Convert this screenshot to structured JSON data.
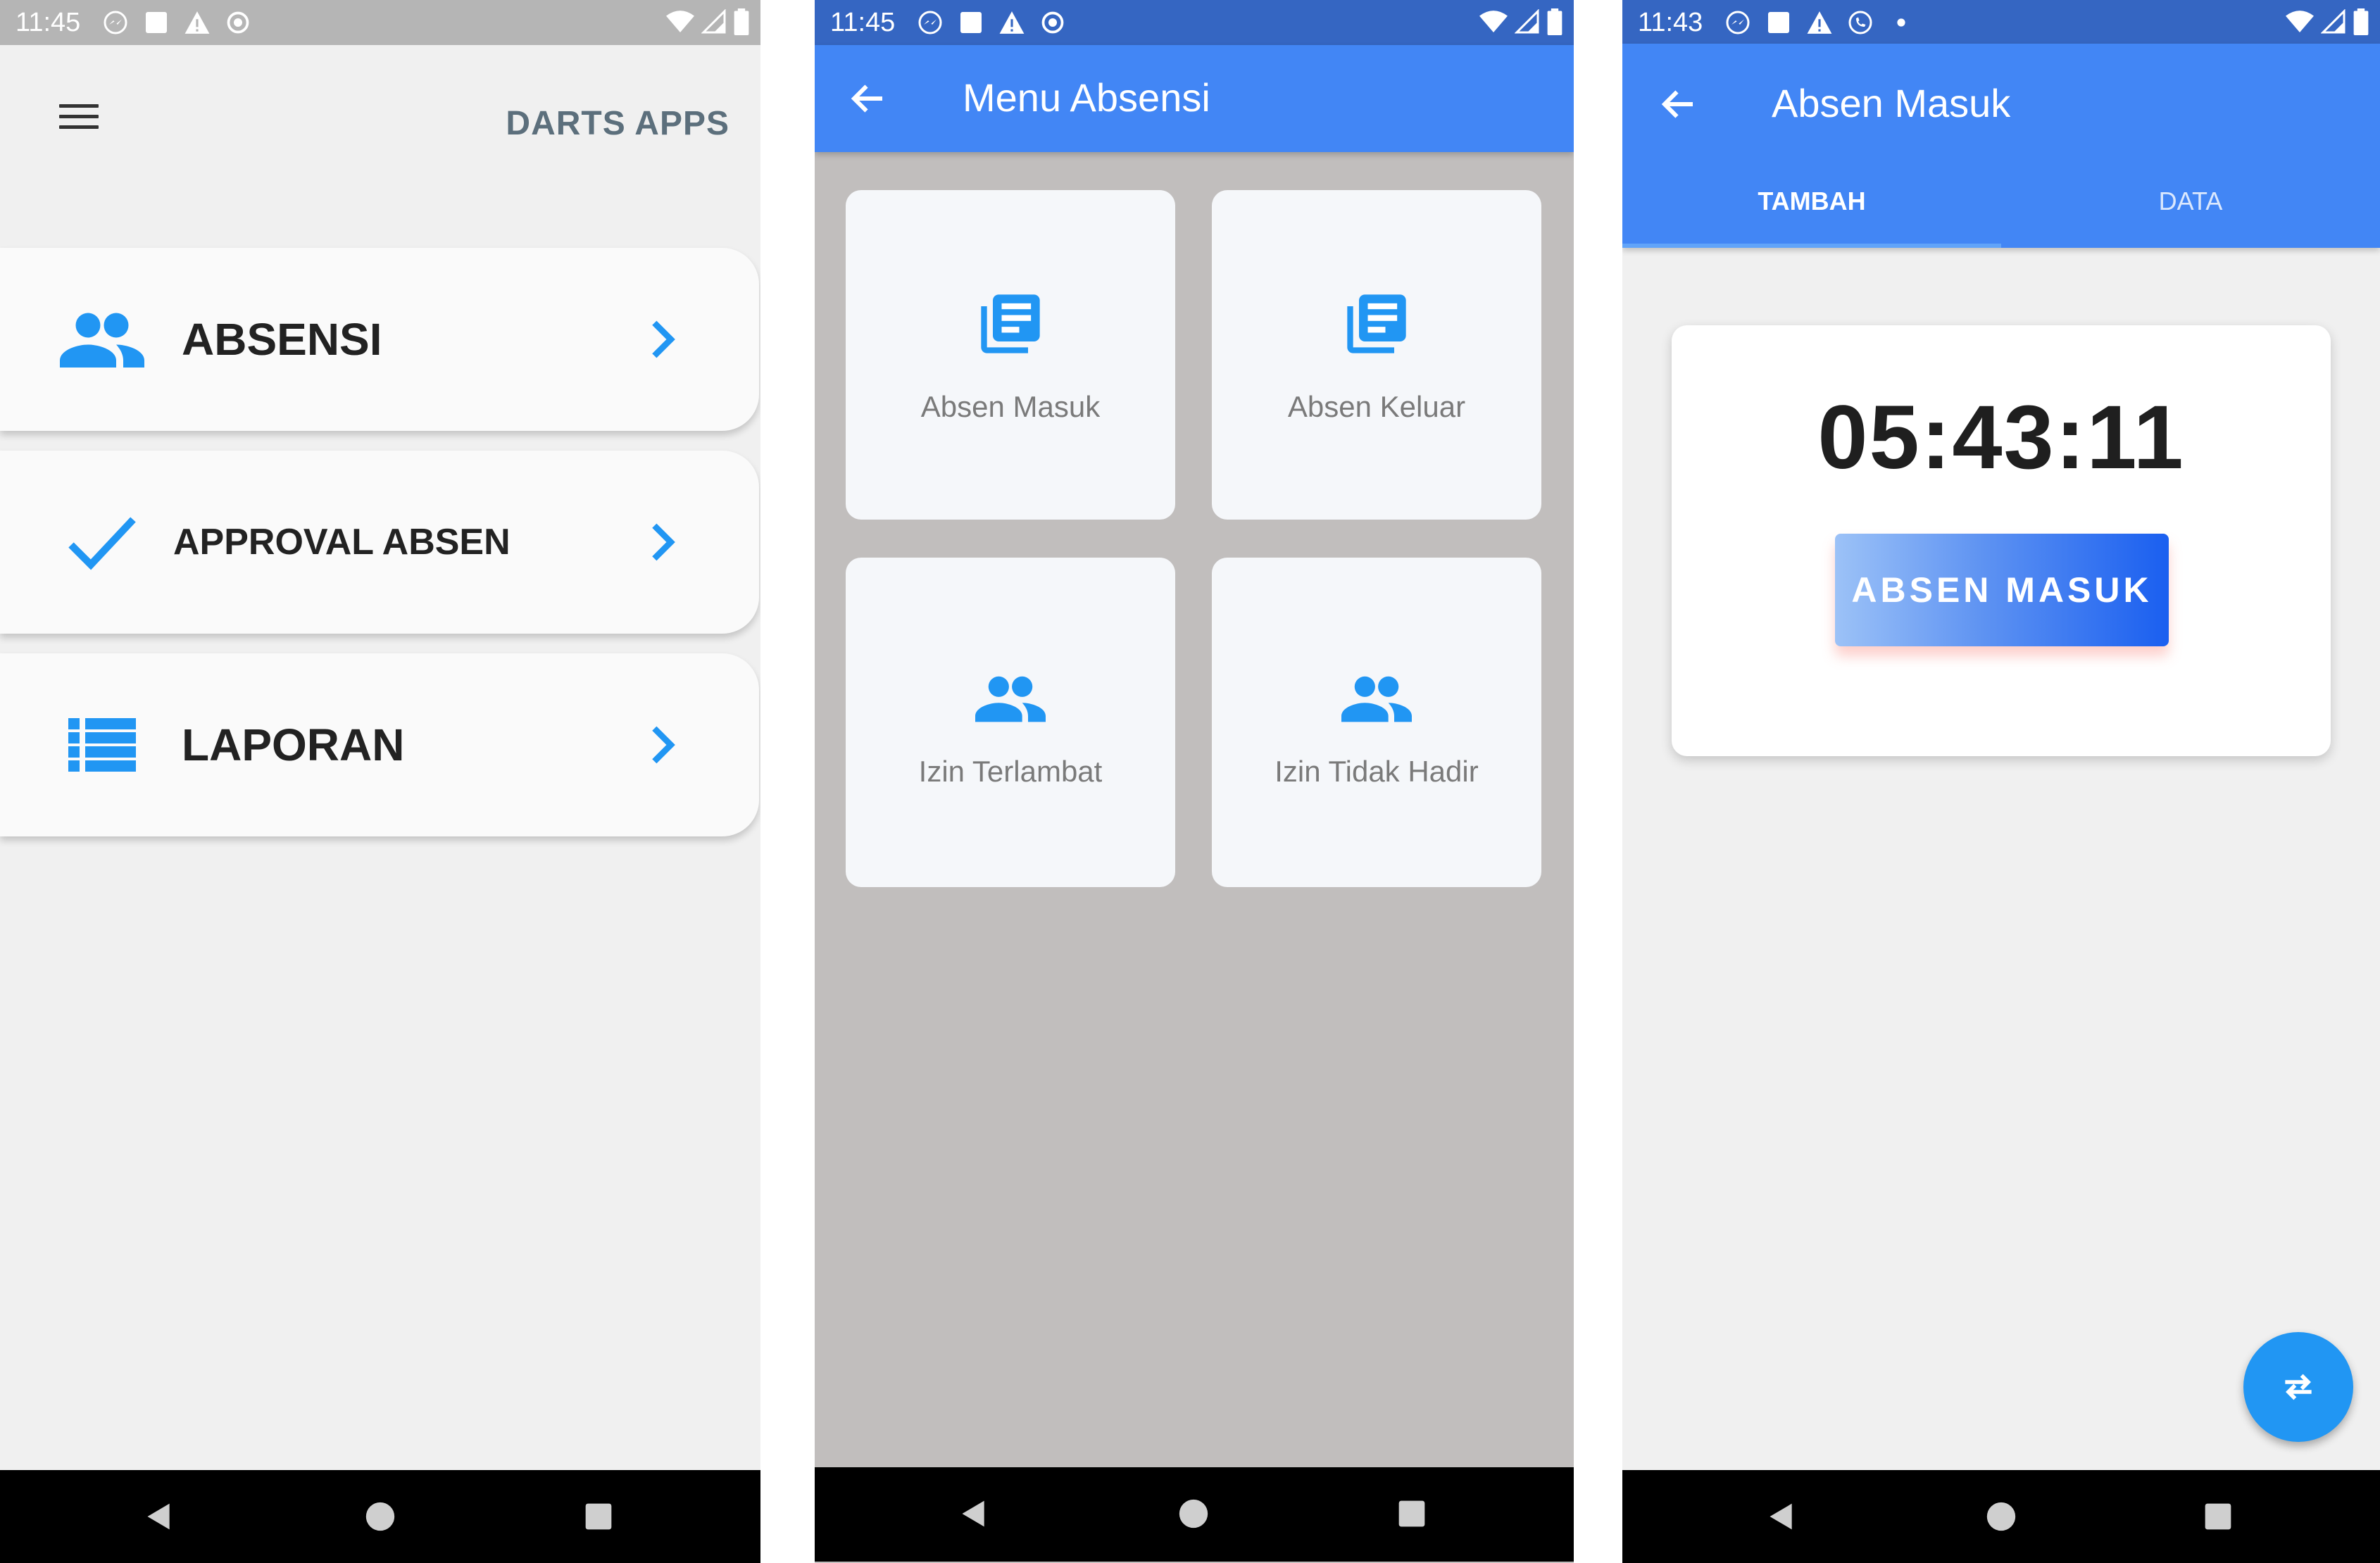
{
  "colors": {
    "primary": "#4286f5",
    "status_dark": "#3566c2",
    "icon_blue": "#2196f3",
    "screen2_bg": "#c1bebd"
  },
  "screen1": {
    "status_time": "11:45",
    "status_icons": [
      "messenger-icon",
      "square-icon",
      "warning-icon",
      "sync-icon"
    ],
    "brand": "DARTS APPS",
    "menu": [
      {
        "label": "ABSENSI",
        "icon": "people-icon"
      },
      {
        "label": "APPROVAL ABSEN",
        "icon": "check-icon"
      },
      {
        "label": "LAPORAN",
        "icon": "list-icon"
      }
    ]
  },
  "screen2": {
    "status_time": "11:45",
    "title": "Menu Absensi",
    "tiles": [
      {
        "label": "Absen Masuk",
        "icon": "library-books-icon"
      },
      {
        "label": "Absen Keluar",
        "icon": "library-books-icon"
      },
      {
        "label": "Izin Terlambat",
        "icon": "people-icon"
      },
      {
        "label": "Izin Tidak Hadir",
        "icon": "people-icon"
      }
    ]
  },
  "screen3": {
    "status_time": "11:43",
    "title": "Absen Masuk",
    "tabs": [
      "TAMBAH",
      "DATA"
    ],
    "active_tab": "TAMBAH",
    "clock": "05:43:11",
    "button_label": "ABSEN MASUK",
    "fab_icon": "swap-icon"
  }
}
